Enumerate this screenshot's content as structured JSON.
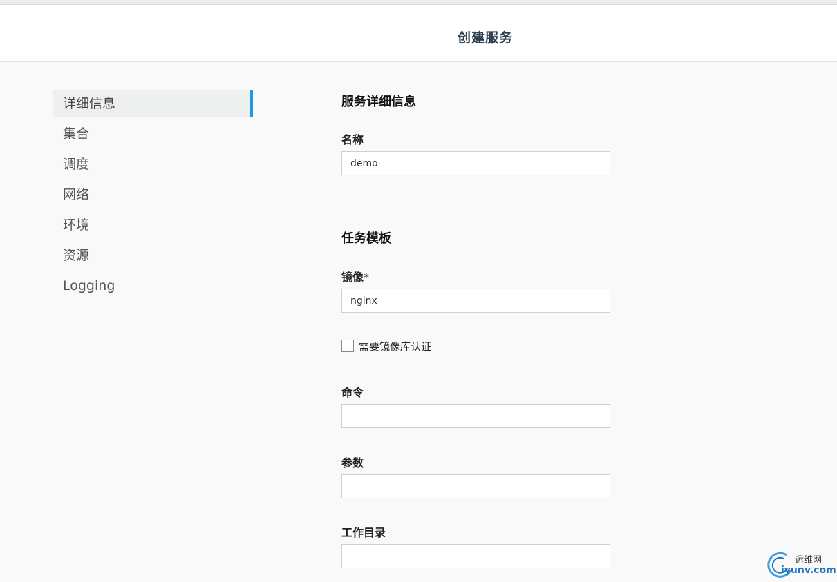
{
  "header": {
    "title": "创建服务"
  },
  "sidebar": {
    "items": [
      {
        "label": "详细信息",
        "active": true
      },
      {
        "label": "集合",
        "active": false
      },
      {
        "label": "调度",
        "active": false
      },
      {
        "label": "网络",
        "active": false
      },
      {
        "label": "环境",
        "active": false
      },
      {
        "label": "资源",
        "active": false
      },
      {
        "label": "Logging",
        "active": false
      }
    ]
  },
  "form": {
    "service_details": {
      "title": "服务详细信息",
      "name": {
        "label": "名称",
        "value": "demo"
      }
    },
    "task_template": {
      "title": "任务模板",
      "image": {
        "label": "镜像",
        "required_mark": "*",
        "value": "nginx"
      },
      "registry_auth": {
        "label": "需要镜像库认证",
        "checked": false
      },
      "command": {
        "label": "命令",
        "value": ""
      },
      "args": {
        "label": "参数",
        "value": ""
      },
      "workdir": {
        "label": "工作目录",
        "value": ""
      }
    }
  },
  "watermark": {
    "cn": "运维网",
    "en": "iyunv.com"
  },
  "colors": {
    "accent": "#1b9ae0",
    "header_title": "#2d3e50",
    "background": "#f9f9f9"
  }
}
